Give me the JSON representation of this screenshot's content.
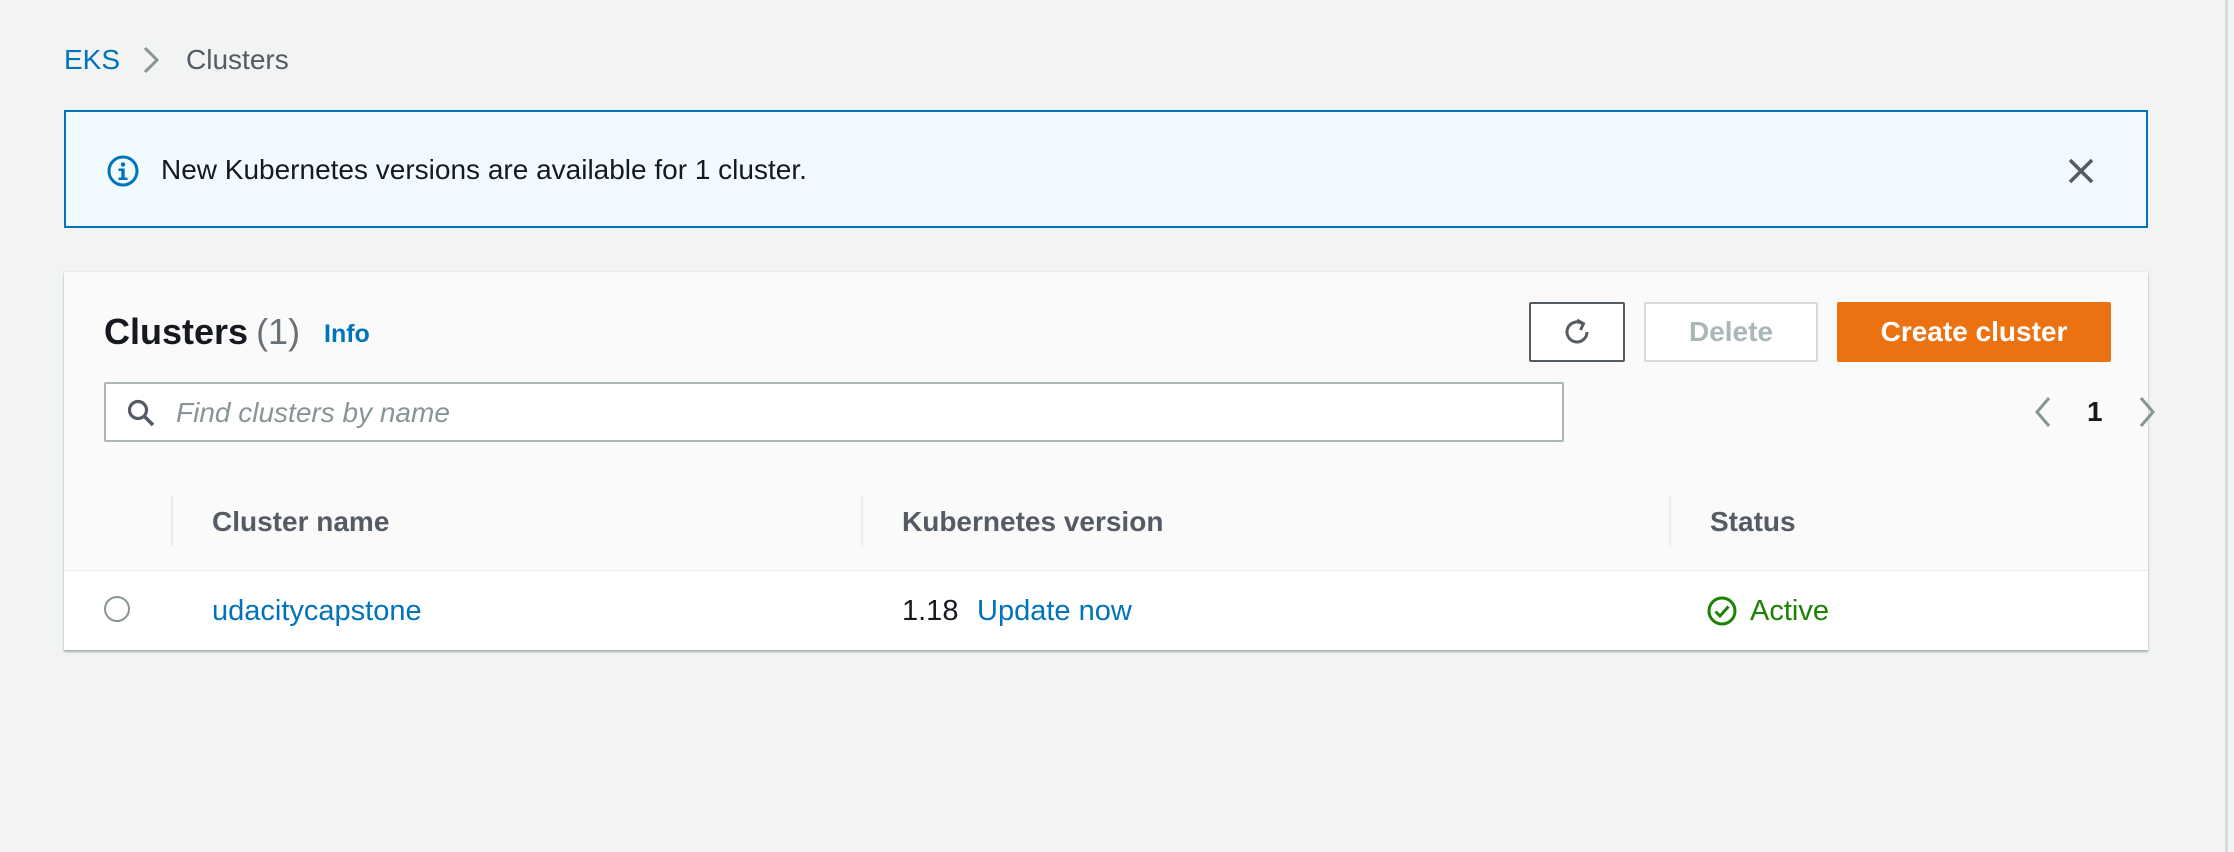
{
  "breadcrumb": {
    "root": "EKS",
    "current": "Clusters"
  },
  "flash": {
    "message": "New Kubernetes versions are available for 1 cluster."
  },
  "clusters_panel": {
    "title": "Clusters",
    "count": "(1)",
    "info_label": "Info",
    "delete_label": "Delete",
    "create_label": "Create cluster",
    "search_placeholder": "Find clusters by name",
    "search_value": "",
    "current_page": "1",
    "columns": {
      "name": "Cluster name",
      "version": "Kubernetes version",
      "status": "Status"
    },
    "rows": [
      {
        "name": "udacitycapstone",
        "version": "1.18",
        "update_label": "Update now",
        "status": "Active"
      }
    ]
  },
  "colors": {
    "link": "#0073bb",
    "primary_button": "#ec7211",
    "success": "#1d8102",
    "flash_border": "#0073bb",
    "flash_background": "#f1faff"
  }
}
